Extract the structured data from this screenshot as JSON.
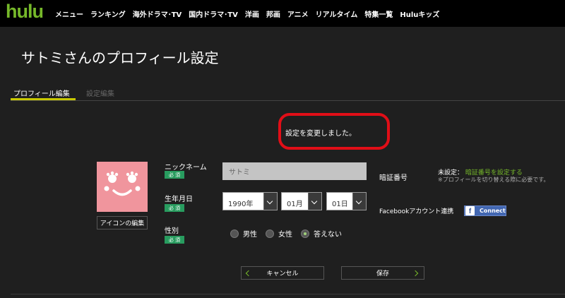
{
  "header": {
    "logo": "hulu",
    "nav": [
      "メニュー",
      "ランキング",
      "海外ドラマ･TV",
      "国内ドラマ･TV",
      "洋画",
      "邦画",
      "アニメ",
      "リアルタイム",
      "特集一覧",
      "Huluキッズ"
    ]
  },
  "page": {
    "title": "サトミさんのプロフィール設定"
  },
  "tabs": {
    "profile": "プロフィール編集",
    "settings": "設定編集"
  },
  "message": "設定を変更しました。",
  "avatar": {
    "edit_label": "アイコンの編集"
  },
  "form": {
    "nickname_label": "ニックネーム",
    "nickname_value": "サトミ",
    "required": "必 須",
    "birth_label": "生年月日",
    "year": "1990年",
    "month": "01月",
    "day": "01日",
    "gender_label": "性別",
    "gender_options": [
      "男性",
      "女性",
      "答えない"
    ]
  },
  "pin": {
    "label": "暗証番号",
    "status_prefix": "未設定：",
    "set_link": "暗証番号を設定する",
    "note": "※プロフィールを切り替える際に必要です。"
  },
  "facebook": {
    "label": "Facebookアカウント連携",
    "icon_glyph": "f",
    "button": "Connect"
  },
  "buttons": {
    "cancel": "キャンセル",
    "save": "保存"
  },
  "colors": {
    "brand": "#76b82a",
    "required_badge": "#289c5f",
    "annotation_red": "#e10e17",
    "avatar_pink": "#f0959d",
    "facebook_blue": "#4267b2"
  }
}
